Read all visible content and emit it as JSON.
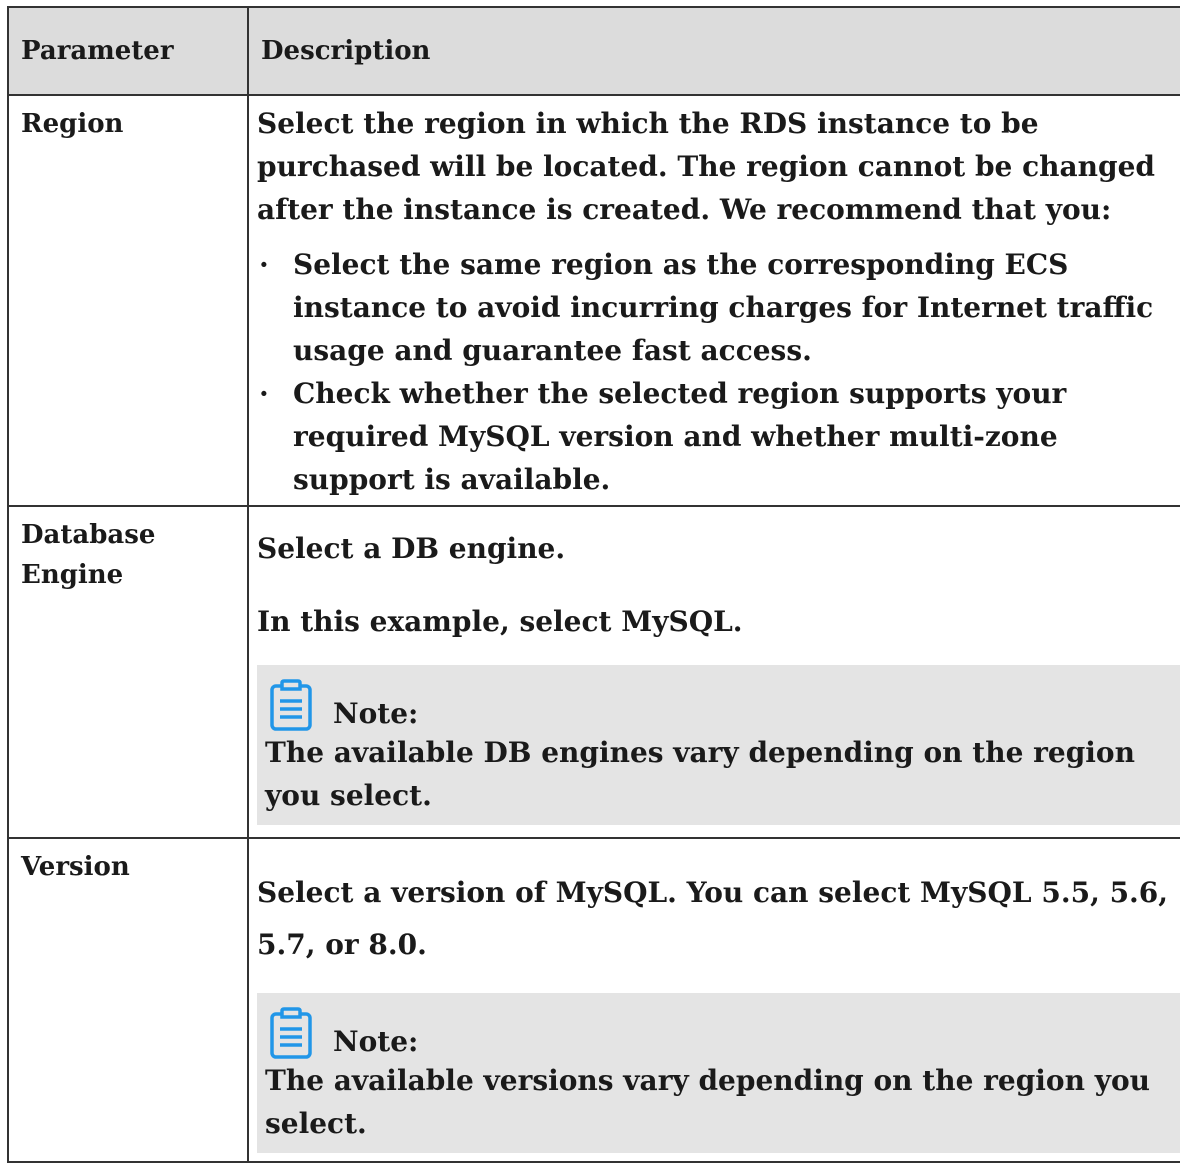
{
  "table": {
    "headers": {
      "parameter": "Parameter",
      "description": "Description"
    },
    "rows": [
      {
        "parameter": "Region",
        "intro": "Select the region in which the RDS instance to be purchased will be located. The region cannot be changed after the instance is created. We recommend that you:",
        "bullets": [
          "Select the same region as the corresponding ECS instance to avoid incurring charges for Internet traffic usage and guarantee fast access.",
          "Check whether the selected region supports your required MySQL version and whether multi-zone support is available."
        ]
      },
      {
        "parameter": "Database Engine",
        "paragraphs": [
          "Select a DB engine.",
          "In this example, select MySQL."
        ],
        "note": {
          "icon": "note-icon",
          "label": "Note:",
          "text": "The available DB engines vary depending on the region you select."
        }
      },
      {
        "parameter": "Version",
        "paragraphs": [
          "Select a version of MySQL. You can select MySQL 5.5, 5.6, 5.7, or 8.0."
        ],
        "note": {
          "icon": "note-icon",
          "label": "Note:",
          "text": "The available versions vary depending on the region you select."
        }
      }
    ]
  },
  "colors": {
    "header_bg": "#dcdcdc",
    "note_bg": "#e4e4e4",
    "note_icon": "#2196e8",
    "border": "#333333"
  }
}
